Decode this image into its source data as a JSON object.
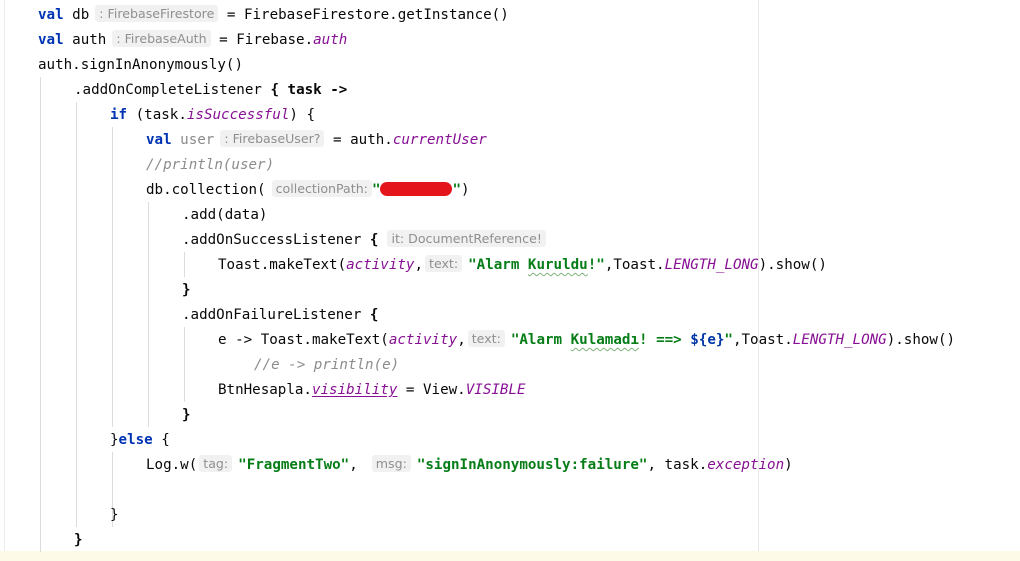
{
  "lines": {
    "l1": {
      "kw": "val",
      "name": "db",
      "hint": ": FirebaseFirestore",
      "rest": " = FirebaseFirestore.getInstance()"
    },
    "l2": {
      "kw": "val",
      "name": "auth",
      "hint": ": FirebaseAuth",
      "rest_a": " = Firebase.",
      "prop": "auth"
    },
    "l3": {
      "text": "auth.signInAnonymously()"
    },
    "l4": {
      "a": ".addOnCompleteListener ",
      "b": "{ task ->"
    },
    "l5": {
      "kw": "if",
      "a": " (task.",
      "prop": "isSuccessful",
      "b": ") {"
    },
    "l6": {
      "kw": "val",
      "name": "user",
      "hint": ": FirebaseUser?",
      "rest_a": " = auth.",
      "prop": "currentUser"
    },
    "l7": {
      "comment": "//println(user)"
    },
    "l8": {
      "a": "db.collection(",
      "hint": "collectionPath:",
      "q1": "\"",
      "q2": "\"",
      "b": ")"
    },
    "l9": {
      "text": ".add(data)"
    },
    "l10": {
      "a": ".addOnSuccessListener ",
      "brace": "{",
      "hint": "it: DocumentReference!"
    },
    "l11": {
      "a": "Toast.makeText(",
      "p1": "activity",
      "c": ",",
      "hint": "text:",
      "s1": "\"Alarm ",
      "s2": "Kuruldu",
      "s3": "!\"",
      "d": ",Toast.",
      "p2": "LENGTH_LONG",
      "e": ").show()"
    },
    "l12": {
      "text": "}"
    },
    "l13": {
      "a": ".addOnFailureListener ",
      "brace": "{"
    },
    "l14": {
      "a": "e -> Toast.makeText(",
      "p1": "activity",
      "c": ",",
      "hint": "text:",
      "s1": "\"Alarm ",
      "s2": "Kulamadı",
      "s3": "! ==> ",
      "tpl": "${e}",
      "s4": "\"",
      "d": ",Toast.",
      "p2": "LENGTH_LONG",
      "e": ").show()"
    },
    "l15": {
      "comment": "//e -> println(e)"
    },
    "l16": {
      "a": "BtnHesapla.",
      "prop": "visibility",
      "b": " = View.",
      "prop2": "VISIBLE"
    },
    "l17": {
      "text": "}"
    },
    "l18": {
      "a": "}",
      "kw": "else",
      "b": " {"
    },
    "l19": {
      "a": "Log.w(",
      "hint1": "tag:",
      "s1": "\"FragmentTwo\"",
      "c": ",",
      "hint2": "msg:",
      "s2": "\"signInAnonymously:failure\"",
      "d": ", task.",
      "prop": "exception",
      "e": ")"
    },
    "l21": {
      "text": "}"
    },
    "l22": {
      "text": "}"
    }
  },
  "colors": {
    "keyword": "#0033b3",
    "property": "#871094",
    "string": "#067d17",
    "comment": "#8c8c8c",
    "hint_bg": "#f1f1f1",
    "redaction": "#e5161b"
  }
}
